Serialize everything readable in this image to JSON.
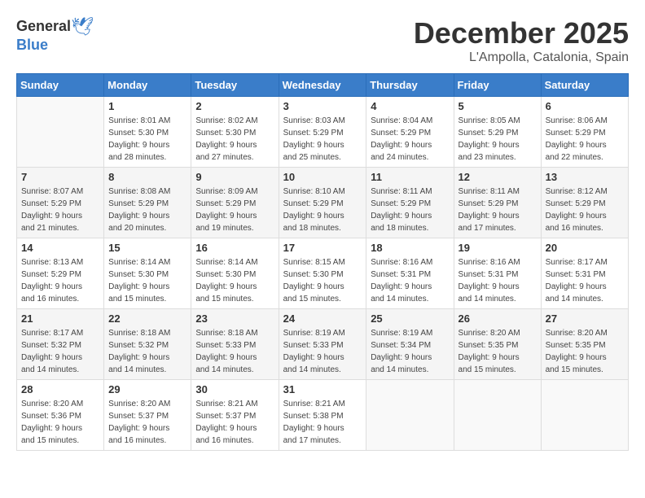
{
  "logo": {
    "general": "General",
    "blue": "Blue"
  },
  "title": "December 2025",
  "location": "L'Ampolla, Catalonia, Spain",
  "headers": [
    "Sunday",
    "Monday",
    "Tuesday",
    "Wednesday",
    "Thursday",
    "Friday",
    "Saturday"
  ],
  "weeks": [
    {
      "days": [
        {
          "number": "",
          "info": ""
        },
        {
          "number": "1",
          "info": "Sunrise: 8:01 AM\nSunset: 5:30 PM\nDaylight: 9 hours\nand 28 minutes."
        },
        {
          "number": "2",
          "info": "Sunrise: 8:02 AM\nSunset: 5:30 PM\nDaylight: 9 hours\nand 27 minutes."
        },
        {
          "number": "3",
          "info": "Sunrise: 8:03 AM\nSunset: 5:29 PM\nDaylight: 9 hours\nand 25 minutes."
        },
        {
          "number": "4",
          "info": "Sunrise: 8:04 AM\nSunset: 5:29 PM\nDaylight: 9 hours\nand 24 minutes."
        },
        {
          "number": "5",
          "info": "Sunrise: 8:05 AM\nSunset: 5:29 PM\nDaylight: 9 hours\nand 23 minutes."
        },
        {
          "number": "6",
          "info": "Sunrise: 8:06 AM\nSunset: 5:29 PM\nDaylight: 9 hours\nand 22 minutes."
        }
      ]
    },
    {
      "days": [
        {
          "number": "7",
          "info": "Sunrise: 8:07 AM\nSunset: 5:29 PM\nDaylight: 9 hours\nand 21 minutes."
        },
        {
          "number": "8",
          "info": "Sunrise: 8:08 AM\nSunset: 5:29 PM\nDaylight: 9 hours\nand 20 minutes."
        },
        {
          "number": "9",
          "info": "Sunrise: 8:09 AM\nSunset: 5:29 PM\nDaylight: 9 hours\nand 19 minutes."
        },
        {
          "number": "10",
          "info": "Sunrise: 8:10 AM\nSunset: 5:29 PM\nDaylight: 9 hours\nand 18 minutes."
        },
        {
          "number": "11",
          "info": "Sunrise: 8:11 AM\nSunset: 5:29 PM\nDaylight: 9 hours\nand 18 minutes."
        },
        {
          "number": "12",
          "info": "Sunrise: 8:11 AM\nSunset: 5:29 PM\nDaylight: 9 hours\nand 17 minutes."
        },
        {
          "number": "13",
          "info": "Sunrise: 8:12 AM\nSunset: 5:29 PM\nDaylight: 9 hours\nand 16 minutes."
        }
      ]
    },
    {
      "days": [
        {
          "number": "14",
          "info": "Sunrise: 8:13 AM\nSunset: 5:29 PM\nDaylight: 9 hours\nand 16 minutes."
        },
        {
          "number": "15",
          "info": "Sunrise: 8:14 AM\nSunset: 5:30 PM\nDaylight: 9 hours\nand 15 minutes."
        },
        {
          "number": "16",
          "info": "Sunrise: 8:14 AM\nSunset: 5:30 PM\nDaylight: 9 hours\nand 15 minutes."
        },
        {
          "number": "17",
          "info": "Sunrise: 8:15 AM\nSunset: 5:30 PM\nDaylight: 9 hours\nand 15 minutes."
        },
        {
          "number": "18",
          "info": "Sunrise: 8:16 AM\nSunset: 5:31 PM\nDaylight: 9 hours\nand 14 minutes."
        },
        {
          "number": "19",
          "info": "Sunrise: 8:16 AM\nSunset: 5:31 PM\nDaylight: 9 hours\nand 14 minutes."
        },
        {
          "number": "20",
          "info": "Sunrise: 8:17 AM\nSunset: 5:31 PM\nDaylight: 9 hours\nand 14 minutes."
        }
      ]
    },
    {
      "days": [
        {
          "number": "21",
          "info": "Sunrise: 8:17 AM\nSunset: 5:32 PM\nDaylight: 9 hours\nand 14 minutes."
        },
        {
          "number": "22",
          "info": "Sunrise: 8:18 AM\nSunset: 5:32 PM\nDaylight: 9 hours\nand 14 minutes."
        },
        {
          "number": "23",
          "info": "Sunrise: 8:18 AM\nSunset: 5:33 PM\nDaylight: 9 hours\nand 14 minutes."
        },
        {
          "number": "24",
          "info": "Sunrise: 8:19 AM\nSunset: 5:33 PM\nDaylight: 9 hours\nand 14 minutes."
        },
        {
          "number": "25",
          "info": "Sunrise: 8:19 AM\nSunset: 5:34 PM\nDaylight: 9 hours\nand 14 minutes."
        },
        {
          "number": "26",
          "info": "Sunrise: 8:20 AM\nSunset: 5:35 PM\nDaylight: 9 hours\nand 15 minutes."
        },
        {
          "number": "27",
          "info": "Sunrise: 8:20 AM\nSunset: 5:35 PM\nDaylight: 9 hours\nand 15 minutes."
        }
      ]
    },
    {
      "days": [
        {
          "number": "28",
          "info": "Sunrise: 8:20 AM\nSunset: 5:36 PM\nDaylight: 9 hours\nand 15 minutes."
        },
        {
          "number": "29",
          "info": "Sunrise: 8:20 AM\nSunset: 5:37 PM\nDaylight: 9 hours\nand 16 minutes."
        },
        {
          "number": "30",
          "info": "Sunrise: 8:21 AM\nSunset: 5:37 PM\nDaylight: 9 hours\nand 16 minutes."
        },
        {
          "number": "31",
          "info": "Sunrise: 8:21 AM\nSunset: 5:38 PM\nDaylight: 9 hours\nand 17 minutes."
        },
        {
          "number": "",
          "info": ""
        },
        {
          "number": "",
          "info": ""
        },
        {
          "number": "",
          "info": ""
        }
      ]
    }
  ]
}
